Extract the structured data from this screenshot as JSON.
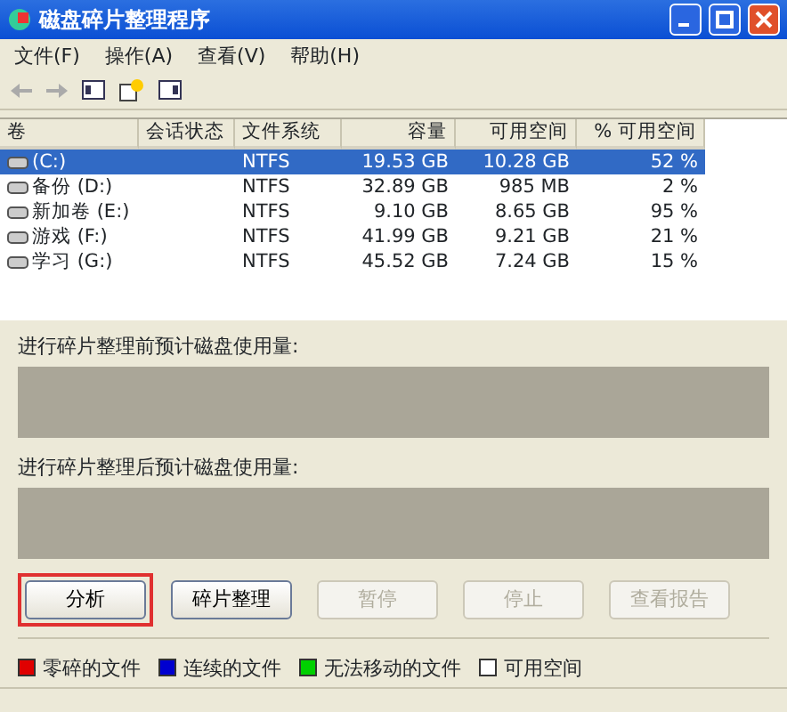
{
  "window": {
    "title": "磁盘碎片整理程序"
  },
  "menu": [
    "文件(F)",
    "操作(A)",
    "查看(V)",
    "帮助(H)"
  ],
  "table": {
    "columns": [
      "卷",
      "会话状态",
      "文件系统",
      "容量",
      "可用空间",
      "% 可用空间"
    ],
    "rows": [
      {
        "cells": [
          "(C:)",
          "",
          "NTFS",
          "19.53 GB",
          "10.28 GB",
          "52 %"
        ],
        "selected": true
      },
      {
        "cells": [
          "备份 (D:)",
          "",
          "NTFS",
          "32.89 GB",
          "985 MB",
          "2 %"
        ],
        "selected": false
      },
      {
        "cells": [
          "新加卷 (E:)",
          "",
          "NTFS",
          "9.10 GB",
          "8.65 GB",
          "95 %"
        ],
        "selected": false
      },
      {
        "cells": [
          "游戏 (F:)",
          "",
          "NTFS",
          "41.99 GB",
          "9.21 GB",
          "21 %"
        ],
        "selected": false
      },
      {
        "cells": [
          "学习 (G:)",
          "",
          "NTFS",
          "45.52 GB",
          "7.24 GB",
          "15 %"
        ],
        "selected": false
      }
    ]
  },
  "usage_panels": [
    {
      "label": "进行碎片整理前预计磁盘使用量:"
    },
    {
      "label": "进行碎片整理后预计磁盘使用量:"
    }
  ],
  "buttons": [
    {
      "label": "分析",
      "disabled": false,
      "highlighted": true
    },
    {
      "label": "碎片整理",
      "disabled": false,
      "highlighted": false
    },
    {
      "label": "暂停",
      "disabled": true,
      "highlighted": false
    },
    {
      "label": "停止",
      "disabled": true,
      "highlighted": false
    },
    {
      "label": "查看报告",
      "disabled": true,
      "highlighted": false
    }
  ],
  "legend": [
    {
      "label": "零碎的文件",
      "color": "#e00000"
    },
    {
      "label": "连续的文件",
      "color": "#0000d0"
    },
    {
      "label": "无法移动的文件",
      "color": "#00d000"
    },
    {
      "label": "可用空间",
      "color": "#ffffff"
    }
  ]
}
